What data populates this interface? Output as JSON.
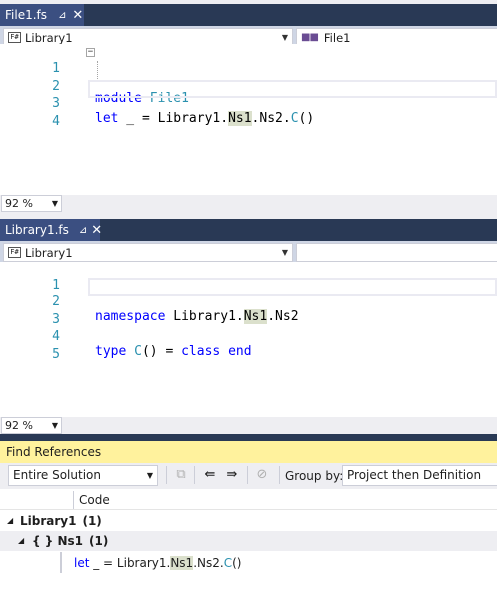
{
  "file1": {
    "tab": {
      "title": "File1.fs",
      "pin": "⊿",
      "close": "✕"
    },
    "nav": {
      "left": "Library1",
      "left_icon": "F#",
      "right": "File1",
      "right_icon": "■■"
    },
    "lines": [
      {
        "num": "1",
        "kw": "module",
        "text": " ",
        "ty": "File1"
      },
      {
        "num": "2"
      },
      {
        "num": "3",
        "kw": "let",
        "t1": " _ = Library1.",
        "hl": "Ns1",
        "t2": ".Ns2.",
        "ty": "C",
        "t3": "()"
      },
      {
        "num": "4"
      }
    ],
    "zoom": "92 %"
  },
  "library1": {
    "tab": {
      "title": "Library1.fs",
      "pin": "⊿",
      "close": "✕"
    },
    "nav": {
      "left": "Library1",
      "left_icon": "F#"
    },
    "lines": [
      {
        "num": "1"
      },
      {
        "num": "2",
        "kw": "namespace",
        "t1": " Library1.",
        "hl": "Ns1",
        "t2": ".Ns2"
      },
      {
        "num": "3"
      },
      {
        "num": "4",
        "kw": "type",
        "ty": "C",
        "t1": "() = ",
        "kw2": "class",
        "kw3": "end"
      },
      {
        "num": "5"
      }
    ],
    "zoom": "92 %"
  },
  "find_references": {
    "title": "Find References",
    "scope": "Entire Solution",
    "group_by_label": "Group by:",
    "group_by_value": "Project then Definition",
    "column_code": "Code",
    "project": {
      "name": "Library1",
      "count": "(1)"
    },
    "definition": {
      "name": "Ns1",
      "count": "(1)",
      "icon": "{ }"
    },
    "reference": {
      "kw": "let",
      "t1": " _ = Library1.",
      "hl": "Ns1",
      "t2": ".Ns2.",
      "ty": "C",
      "t3": "()"
    }
  },
  "colors": {
    "tab_active": "#3b4f81",
    "tab_strip": "#293955",
    "keyword": "#0000ff",
    "type": "#2b91af",
    "highlight": "#dbe0cc",
    "find_refs_title": "#fff29d"
  }
}
